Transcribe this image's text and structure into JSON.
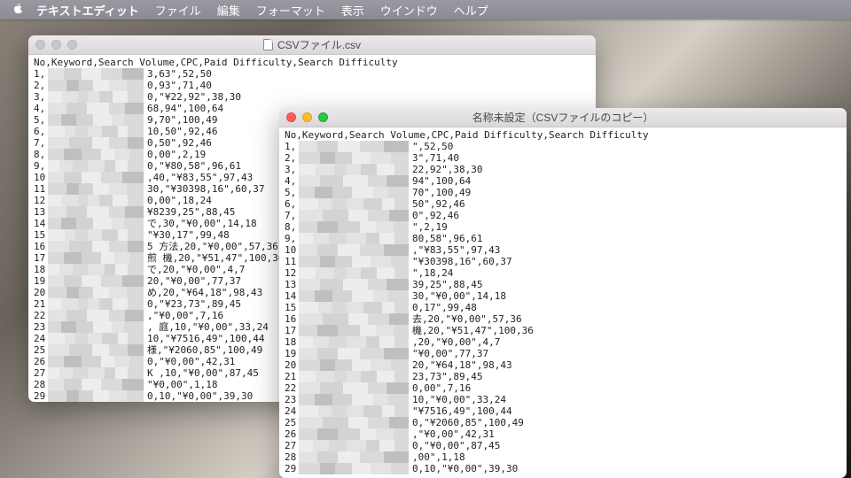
{
  "menubar": {
    "appname": "テキストエディット",
    "items": [
      "ファイル",
      "編集",
      "フォーマット",
      "表示",
      "ウインドウ",
      "ヘルプ"
    ]
  },
  "windows": {
    "back": {
      "title": "CSVファイル.csv",
      "header": "No,Keyword,Search Volume,CPC,Paid Difficulty,Search Difficulty",
      "rows": [
        {
          "no": "1,",
          "tail": "3,63\",52,50"
        },
        {
          "no": "2,",
          "tail": "0,93\",71,40"
        },
        {
          "no": "3,",
          "tail": "0,\"¥22,92\",38,30"
        },
        {
          "no": "4,",
          "tail": "68,94\",100,64"
        },
        {
          "no": "5,",
          "tail": "9,70\",100,49"
        },
        {
          "no": "6,",
          "tail": "10,50\",92,46"
        },
        {
          "no": "7,",
          "tail": "0,50\",92,46"
        },
        {
          "no": "8,",
          "tail": "0,00\",2,19"
        },
        {
          "no": "9,",
          "tail": "0,\"¥80,58\",96,61"
        },
        {
          "no": "10",
          "tail": ",40,\"¥83,55\",97,43"
        },
        {
          "no": "11",
          "tail": "30,\"¥30398,16\",60,37"
        },
        {
          "no": "12",
          "tail": "0,00\",18,24"
        },
        {
          "no": "13",
          "tail": "¥8239,25\",88,45"
        },
        {
          "no": "14",
          "tail": "で,30,\"¥0,00\",14,18"
        },
        {
          "no": "15",
          "tail": "\"¥30,17\",99,48"
        },
        {
          "no": "16",
          "tail": "5 方法,20,\"¥0,00\",57,36"
        },
        {
          "no": "17",
          "tail": " 煎 機,20,\"¥51,47\",100,36"
        },
        {
          "no": "18",
          "tail": " で,20,\"¥0,00\",4,7"
        },
        {
          "no": "19",
          "tail": "20,\"¥0,00\",77,37"
        },
        {
          "no": "20",
          "tail": "め,20,\"¥64,18\",98,43"
        },
        {
          "no": "21",
          "tail": "0,\"¥23,73\",89,45"
        },
        {
          "no": "22",
          "tail": ",\"¥0,00\",7,16"
        },
        {
          "no": "23",
          "tail": ", 庭,10,\"¥0,00\",33,24"
        },
        {
          "no": "24",
          "tail": "10,\"¥7516,49\",100,44"
        },
        {
          "no": "25",
          "tail": "様,\"¥2060,85\",100,49"
        },
        {
          "no": "26",
          "tail": "0,\"¥0,00\",42,31"
        },
        {
          "no": "27",
          "tail": "K ,10,\"¥0,00\",87,45"
        },
        {
          "no": "28",
          "tail": "\"¥0,00\",1,18"
        },
        {
          "no": "29",
          "tail": "0,10,\"¥0,00\",39,30"
        }
      ]
    },
    "front": {
      "title": "名称未設定（CSVファイルのコピー）",
      "header": "No,Keyword,Search Volume,CPC,Paid Difficulty,Search Difficulty",
      "rows": [
        {
          "no": "1,",
          "tail": "\",52,50"
        },
        {
          "no": "2,",
          "tail": "3\",71,40"
        },
        {
          "no": "3,",
          "tail": "22,92\",38,30"
        },
        {
          "no": "4,",
          "tail": "94\",100,64"
        },
        {
          "no": "5,",
          "tail": "70\",100,49"
        },
        {
          "no": "6,",
          "tail": "50\",92,46"
        },
        {
          "no": "7,",
          "tail": "0\",92,46"
        },
        {
          "no": "8,",
          "tail": "\",2,19"
        },
        {
          "no": "9,",
          "tail": "80,58\",96,61"
        },
        {
          "no": "10",
          "tail": ",\"¥83,55\",97,43"
        },
        {
          "no": "11",
          "tail": "\"¥30398,16\",60,37"
        },
        {
          "no": "12",
          "tail": "\",18,24"
        },
        {
          "no": "13",
          "tail": "39,25\",88,45"
        },
        {
          "no": "14",
          "tail": "30,\"¥0,00\",14,18"
        },
        {
          "no": "15",
          "tail": "0,17\",99,48"
        },
        {
          "no": "16",
          "tail": "去,20,\"¥0,00\",57,36"
        },
        {
          "no": "17",
          "tail": "機,20,\"¥51,47\",100,36"
        },
        {
          "no": "18",
          "tail": ",20,\"¥0,00\",4,7"
        },
        {
          "no": "19",
          "tail": "\"¥0,00\",77,37"
        },
        {
          "no": "20",
          "tail": "20,\"¥64,18\",98,43"
        },
        {
          "no": "21",
          "tail": "23,73\",89,45"
        },
        {
          "no": "22",
          "tail": "0,00\",7,16"
        },
        {
          "no": "23",
          "tail": "10,\"¥0,00\",33,24"
        },
        {
          "no": "24",
          "tail": "\"¥7516,49\",100,44"
        },
        {
          "no": "25",
          "tail": "0,\"¥2060,85\",100,49"
        },
        {
          "no": "26",
          "tail": ",\"¥0,00\",42,31"
        },
        {
          "no": "27",
          "tail": "0,\"¥0,00\",87,45"
        },
        {
          "no": "28",
          "tail": ",00\",1,18"
        },
        {
          "no": "29",
          "tail": "0,10,\"¥0,00\",39,30"
        }
      ]
    }
  }
}
